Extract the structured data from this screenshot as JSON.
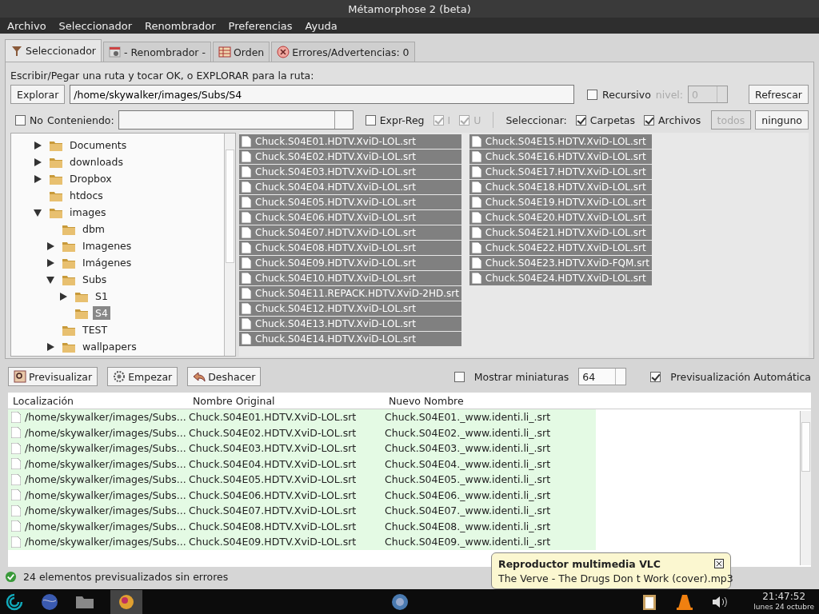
{
  "window": {
    "title": "Métamorphose 2 (beta)"
  },
  "menu": [
    "Archivo",
    "Seleccionador",
    "Renombrador",
    "Preferencias",
    "Ayuda"
  ],
  "tabs": [
    {
      "label": "Seleccionador",
      "selected": true
    },
    {
      "label": "- Renombrador -",
      "selected": false
    },
    {
      "label": "Orden",
      "selected": false
    },
    {
      "label": "Errores/Advertencias: 0",
      "selected": false
    }
  ],
  "selector": {
    "instructions": "Escribir/Pegar una ruta y tocar OK, o EXPLORAR para la ruta:",
    "browse_button": "Explorar",
    "path": "/home/skywalker/images/Subs/S4",
    "recursive": {
      "label": "Recursivo",
      "checked": false
    },
    "level": {
      "label": "nivel:",
      "value": "0",
      "disabled": true
    },
    "refresh_button": "Refrescar",
    "not": {
      "label": "No",
      "checked": false
    },
    "containing_label": "Conteniendo:",
    "regex": {
      "label": "Expr-Reg",
      "checked": false
    },
    "flag_i": {
      "label": "I",
      "checked": true,
      "disabled": true
    },
    "flag_u": {
      "label": "U",
      "checked": true,
      "disabled": true
    },
    "select_label": "Seleccionar:",
    "folders": {
      "label": "Carpetas",
      "checked": true
    },
    "files": {
      "label": "Archivos",
      "checked": true
    },
    "all_button": {
      "label": "todos",
      "disabled": true
    },
    "none_button": {
      "label": "ninguno",
      "disabled": false
    }
  },
  "tree": [
    {
      "label": "Documents",
      "expanded": false,
      "selected": false
    },
    {
      "label": "downloads",
      "expanded": false,
      "selected": false
    },
    {
      "label": "Dropbox",
      "expanded": false,
      "selected": false
    },
    {
      "label": "htdocs",
      "selected": false
    },
    {
      "label": "images",
      "expanded": true,
      "selected": false,
      "children": [
        {
          "label": "dbm",
          "selected": false
        },
        {
          "label": "Imagenes",
          "expanded": false,
          "selected": false
        },
        {
          "label": "Imágenes",
          "expanded": false,
          "selected": false
        },
        {
          "label": "Subs",
          "expanded": true,
          "selected": false,
          "children": [
            {
              "label": "S1",
              "expanded": false,
              "selected": false
            },
            {
              "label": "S4",
              "selected": true
            }
          ]
        },
        {
          "label": "TEST",
          "selected": false
        },
        {
          "label": "wallpapers",
          "expanded": false,
          "selected": false
        }
      ]
    }
  ],
  "files": [
    {
      "name": "Chuck.S04E01.HDTV.XviD-LOL.srt",
      "selected": true
    },
    {
      "name": "Chuck.S04E02.HDTV.XviD-LOL.srt",
      "selected": true
    },
    {
      "name": "Chuck.S04E03.HDTV.XviD-LOL.srt",
      "selected": true
    },
    {
      "name": "Chuck.S04E04.HDTV.XviD-LOL.srt",
      "selected": true
    },
    {
      "name": "Chuck.S04E05.HDTV.XviD-LOL.srt",
      "selected": true
    },
    {
      "name": "Chuck.S04E06.HDTV.XviD-LOL.srt",
      "selected": true
    },
    {
      "name": "Chuck.S04E07.HDTV.XviD-LOL.srt",
      "selected": true
    },
    {
      "name": "Chuck.S04E08.HDTV.XviD-LOL.srt",
      "selected": true
    },
    {
      "name": "Chuck.S04E09.HDTV.XviD-LOL.srt",
      "selected": true
    },
    {
      "name": "Chuck.S04E10.HDTV.XviD-LOL.srt",
      "selected": true
    },
    {
      "name": "Chuck.S04E11.REPACK.HDTV.XviD-2HD.srt",
      "selected": true
    },
    {
      "name": "Chuck.S04E12.HDTV.XviD-LOL.srt",
      "selected": true
    },
    {
      "name": "Chuck.S04E13.HDTV.XviD-LOL.srt",
      "selected": true
    },
    {
      "name": "Chuck.S04E14.HDTV.XviD-LOL.srt",
      "selected": true
    },
    {
      "name": "Chuck.S04E15.HDTV.XviD-LOL.srt",
      "selected": true
    },
    {
      "name": "Chuck.S04E16.HDTV.XviD-LOL.srt",
      "selected": true
    },
    {
      "name": "Chuck.S04E17.HDTV.XviD-LOL.srt",
      "selected": true
    },
    {
      "name": "Chuck.S04E18.HDTV.XviD-LOL.srt",
      "selected": true
    },
    {
      "name": "Chuck.S04E19.HDTV.XviD-LOL.srt",
      "selected": true
    },
    {
      "name": "Chuck.S04E20.HDTV.XviD-LOL.srt",
      "selected": true
    },
    {
      "name": "Chuck.S04E21.HDTV.XviD-LOL.srt",
      "selected": true
    },
    {
      "name": "Chuck.S04E22.HDTV.XviD-LOL.srt",
      "selected": true
    },
    {
      "name": "Chuck.S04E23.HDTV.XviD-FQM.srt",
      "selected": true
    },
    {
      "name": "Chuck.S04E24.HDTV.XviD-LOL.srt",
      "selected": true
    }
  ],
  "actions": [
    "Previsualizar",
    "Empezar",
    "Deshacer"
  ],
  "thumbnails": {
    "label": "Mostrar miniaturas",
    "checked": false,
    "size": "64"
  },
  "auto_preview": {
    "label": "Previsualización Automática",
    "checked": true
  },
  "table": {
    "columns": [
      "Localización",
      "Nombre Original",
      "Nuevo Nombre"
    ],
    "rows": [
      [
        "/home/skywalker/images/Subs...",
        "Chuck.S04E01.HDTV.XviD-LOL.srt",
        "Chuck.S04E01._www.identi.li_.srt"
      ],
      [
        "/home/skywalker/images/Subs...",
        "Chuck.S04E02.HDTV.XviD-LOL.srt",
        "Chuck.S04E02._www.identi.li_.srt"
      ],
      [
        "/home/skywalker/images/Subs...",
        "Chuck.S04E03.HDTV.XviD-LOL.srt",
        "Chuck.S04E03._www.identi.li_.srt"
      ],
      [
        "/home/skywalker/images/Subs...",
        "Chuck.S04E04.HDTV.XviD-LOL.srt",
        "Chuck.S04E04._www.identi.li_.srt"
      ],
      [
        "/home/skywalker/images/Subs...",
        "Chuck.S04E05.HDTV.XviD-LOL.srt",
        "Chuck.S04E05._www.identi.li_.srt"
      ],
      [
        "/home/skywalker/images/Subs...",
        "Chuck.S04E06.HDTV.XviD-LOL.srt",
        "Chuck.S04E06._www.identi.li_.srt"
      ],
      [
        "/home/skywalker/images/Subs...",
        "Chuck.S04E07.HDTV.XviD-LOL.srt",
        "Chuck.S04E07._www.identi.li_.srt"
      ],
      [
        "/home/skywalker/images/Subs...",
        "Chuck.S04E08.HDTV.XviD-LOL.srt",
        "Chuck.S04E08._www.identi.li_.srt"
      ],
      [
        "/home/skywalker/images/Subs...",
        "Chuck.S04E09.HDTV.XviD-LOL.srt",
        "Chuck.S04E09._www.identi.li_.srt"
      ]
    ]
  },
  "status_bar": {
    "text": "24 elementos previsualizados sin errores",
    "ok": true
  },
  "notification": {
    "title": "Reproductor multimedia VLC",
    "text": "The Verve - The Drugs Don t Work (cover).mp3"
  },
  "taskbar": {
    "time": "21:47:52",
    "date": "lunes 24 octubre"
  }
}
